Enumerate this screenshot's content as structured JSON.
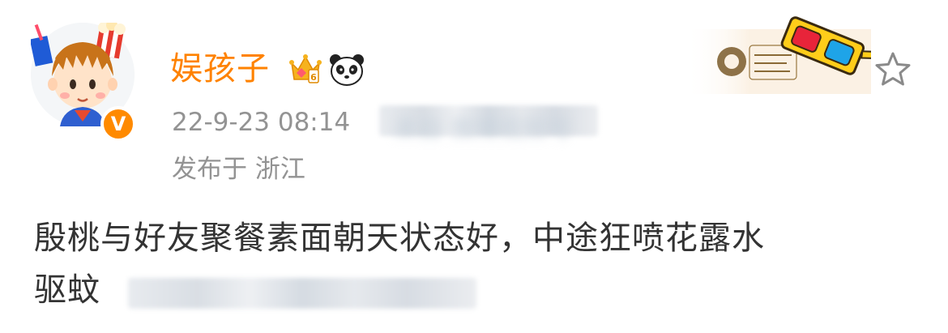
{
  "post": {
    "author": "娱孩子",
    "time": "22-9-23 08:14",
    "source": "来自 微博视频号",
    "location": "发布于 浙江",
    "text_line1": "殷桃与好友聚餐素面朝天状态好，中途狂喷花露水",
    "text_line2": "驱蚊",
    "verified_badge": "V"
  },
  "icons": {
    "crown": "crown-vip-icon",
    "panda": "panda-icon",
    "star": "star-favorite-icon",
    "glasses": "3d-glasses-icon",
    "badge": "weibo-movie-night-badge"
  },
  "colors": {
    "username": "#ff8200",
    "meta": "#939393",
    "body_text": "#333333",
    "verified": "#ff8a00"
  }
}
